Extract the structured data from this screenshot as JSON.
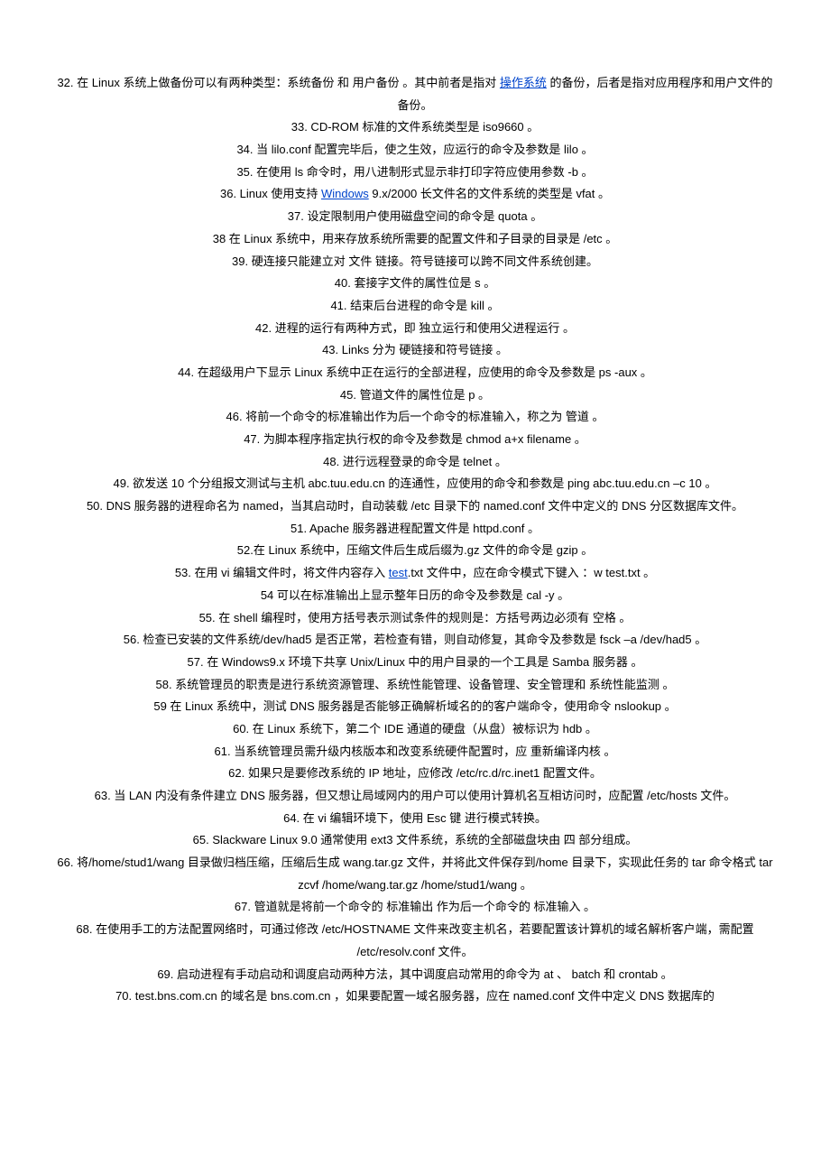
{
  "lines": [
    {
      "pre": "32. 在 Linux 系统上做备份可以有两种类型：系统备份 和 用户备份 。其中前者是指对 ",
      "link": "操作系统",
      "post": " 的备份，后者是指对应用程序和用户文件的备份。"
    },
    {
      "pre": "33. CD-ROM 标准的文件系统类型是 iso9660 。"
    },
    {
      "pre": "34. 当 lilo.conf 配置完毕后，使之生效，应运行的命令及参数是 lilo 。"
    },
    {
      "pre": "35. 在使用 ls 命令时，用八进制形式显示非打印字符应使用参数 -b 。"
    },
    {
      "pre": "36. Linux 使用支持 ",
      "link": "Windows",
      "post": " 9.x/2000 长文件名的文件系统的类型是 vfat 。"
    },
    {
      "pre": "37. 设定限制用户使用磁盘空间的命令是 quota 。"
    },
    {
      "pre": "38 在 Linux 系统中，用来存放系统所需要的配置文件和子目录的目录是 /etc 。"
    },
    {
      "pre": "39. 硬连接只能建立对 文件 链接。符号链接可以跨不同文件系统创建。"
    },
    {
      "pre": "40. 套接字文件的属性位是 s 。"
    },
    {
      "pre": "41. 结束后台进程的命令是 kill 。"
    },
    {
      "pre": "42. 进程的运行有两种方式，即 独立运行和使用父进程运行 。"
    },
    {
      "pre": "43. Links 分为 硬链接和符号链接 。"
    },
    {
      "pre": "44. 在超级用户下显示 Linux 系统中正在运行的全部进程，应使用的命令及参数是 ps -aux 。"
    },
    {
      "pre": "45. 管道文件的属性位是 p 。"
    },
    {
      "pre": "46. 将前一个命令的标准输出作为后一个命令的标准输入，称之为 管道 。"
    },
    {
      "pre": "47. 为脚本程序指定执行权的命令及参数是 chmod a+x filename 。"
    },
    {
      "pre": "48. 进行远程登录的命令是 telnet 。"
    },
    {
      "pre": "49. 欲发送 10 个分组报文测试与主机 abc.tuu.edu.cn 的连通性，应使用的命令和参数是   ping abc.tuu.edu.cn –c 10 。"
    },
    {
      "pre": "50. DNS 服务器的进程命名为 named，当其启动时，自动装载 /etc 目录下的 named.conf 文件中定义的 DNS 分区数据库文件。"
    },
    {
      "pre": "51. Apache 服务器进程配置文件是 httpd.conf 。"
    },
    {
      "pre": "52.在 Linux 系统中，压缩文件后生成后缀为.gz 文件的命令是 gzip 。"
    },
    {
      "pre": "53. 在用 vi 编辑文件时，将文件内容存入 ",
      "link": "test",
      "post": ".txt 文件中，应在命令模式下键入 ：w test.txt 。"
    },
    {
      "pre": "54 可以在标准输出上显示整年日历的命令及参数是 cal -y 。"
    },
    {
      "pre": "55. 在 shell 编程时，使用方括号表示测试条件的规则是：方括号两边必须有 空格 。"
    },
    {
      "pre": "56. 检查已安装的文件系统/dev/had5 是否正常，若检查有错，则自动修复，其命令及参数是 fsck –a /dev/had5 。"
    },
    {
      "pre": "57. 在 Windows9.x 环境下共享 Unix/Linux 中的用户目录的一个工具是 Samba 服务器 。"
    },
    {
      "pre": "58. 系统管理员的职责是进行系统资源管理、系统性能管理、设备管理、安全管理和 系统性能监测 。"
    },
    {
      "pre": "59 在 Linux 系统中，测试 DNS 服务器是否能够正确解析域名的的客户端命令，使用命令 nslookup 。"
    },
    {
      "pre": "60. 在 Linux 系统下，第二个 IDE 通道的硬盘（从盘）被标识为 hdb 。"
    },
    {
      "pre": "61. 当系统管理员需升级内核版本和改变系统硬件配置时，应 重新编译内核 。"
    },
    {
      "pre": "62. 如果只是要修改系统的 IP 地址，应修改 /etc/rc.d/rc.inet1 配置文件。"
    },
    {
      "pre": "63. 当 LAN 内没有条件建立 DNS 服务器，但又想让局域网内的用户可以使用计算机名互相访问时，应配置 /etc/hosts 文件。"
    },
    {
      "pre": "64. 在 vi 编辑环境下，使用 Esc 键 进行模式转换。"
    },
    {
      "pre": "65. Slackware Linux 9.0 通常使用 ext3 文件系统，系统的全部磁盘块由 四 部分组成。"
    },
    {
      "pre": "66. 将/home/stud1/wang 目录做归档压缩，压缩后生成 wang.tar.gz 文件，并将此文件保存到/home 目录下，实现此任务的 tar 命令格式 tar zcvf /home/wang.tar.gz /home/stud1/wang 。"
    },
    {
      "pre": "67. 管道就是将前一个命令的 标准输出 作为后一个命令的 标准输入 。"
    },
    {
      "pre": "68. 在使用手工的方法配置网络时，可通过修改 /etc/HOSTNAME 文件来改变主机名，若要配置该计算机的域名解析客户端，需配置 /etc/resolv.conf 文件。"
    },
    {
      "pre": "69. 启动进程有手动启动和调度启动两种方法，其中调度启动常用的命令为 at 、 batch 和 crontab 。"
    },
    {
      "pre": "70. test.bns.com.cn 的域名是 bns.com.cn ，如果要配置一域名服务器，应在 named.conf 文件中定义 DNS 数据库的"
    }
  ]
}
